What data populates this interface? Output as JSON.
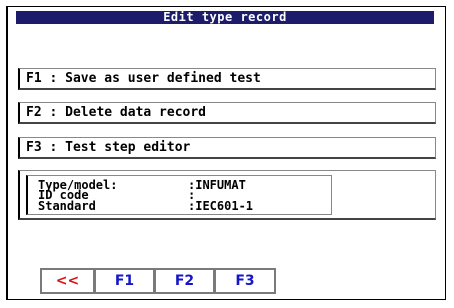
{
  "window": {
    "title": "Edit type record"
  },
  "menu": {
    "items": [
      "F1 : Save as user defined test",
      "F2 : Delete data record",
      "F3 : Test step editor"
    ]
  },
  "info": {
    "rows": [
      {
        "label": "Type/model:",
        "value": ":INFUMAT"
      },
      {
        "label": "ID code",
        "value": ":"
      },
      {
        "label": "Standard",
        "value": ":IEC601-1"
      }
    ]
  },
  "buttons": {
    "back": "<<",
    "f1": "F1",
    "f2": "F2",
    "f3": "F3",
    "back_color": "#e01010",
    "fkey_color": "#1616c8"
  }
}
